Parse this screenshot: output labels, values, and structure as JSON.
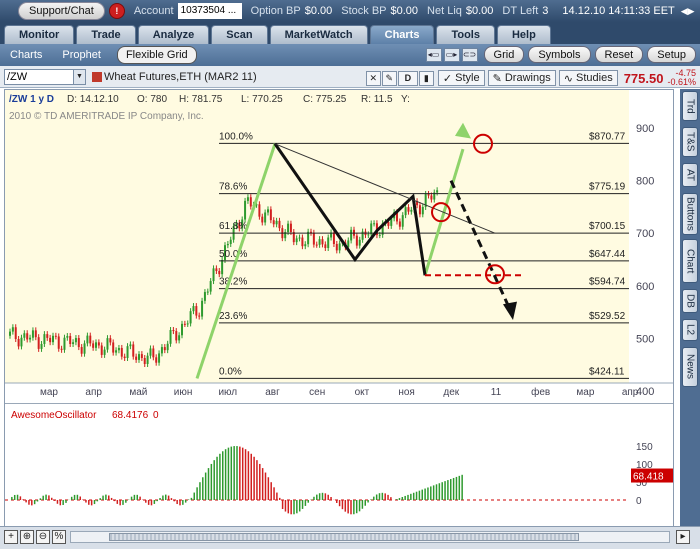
{
  "topbar": {
    "support_label": "Support/Chat",
    "alert_count": "!",
    "account_label": "Account",
    "account_value": "10373504 ...",
    "option_bp_label": "Option BP",
    "option_bp_value": "$0.00",
    "stock_bp_label": "Stock BP",
    "stock_bp_value": "$0.00",
    "net_liq_label": "Net Liq",
    "net_liq_value": "$0.00",
    "dt_left_label": "DT Left",
    "dt_left_value": "3",
    "datetime": "14.12.10 14:11:33 EET"
  },
  "nav": {
    "tabs": [
      "Monitor",
      "Trade",
      "Analyze",
      "Scan",
      "MarketWatch",
      "Charts",
      "Tools",
      "Help"
    ],
    "active": "Charts"
  },
  "subnav": {
    "tabs": [
      "Charts",
      "Prophet",
      "Flexible Grid"
    ],
    "active": "Flexible Grid",
    "buttons": {
      "grid": "Grid",
      "symbols": "Symbols",
      "reset": "Reset",
      "setup": "Setup"
    }
  },
  "chartbar": {
    "symbol": "/ZW",
    "description": "Wheat Futures,ETH (MAR2 11)",
    "d_label": "D",
    "style_label": "Style",
    "drawings_label": "Drawings",
    "studies_label": "Studies",
    "last_price": "775.50",
    "change": "-4.75",
    "change_pct": "-0.61%"
  },
  "chart_info": {
    "symbol_period": "/ZW 1 y D",
    "date": "D: 14.12.10",
    "open": "O: 780",
    "high": "H: 781.75",
    "low": "L: 770.25",
    "close": "C: 775.25",
    "range": "R: 11.5",
    "y_label": "Y:",
    "copyright": "2010 © TD AMERITRADE IP Company, Inc."
  },
  "fib_levels": [
    {
      "pct": "100.0%",
      "price": "$870.77",
      "value": 870.77
    },
    {
      "pct": "78.6%",
      "price": "$775.19",
      "value": 775.19
    },
    {
      "pct": "61.8%",
      "price": "$700.15",
      "value": 700.15
    },
    {
      "pct": "50.0%",
      "price": "$647.44",
      "value": 647.44
    },
    {
      "pct": "38.2%",
      "price": "$594.74",
      "value": 594.74
    },
    {
      "pct": "23.6%",
      "price": "$529.52",
      "value": 529.52
    },
    {
      "pct": "0.0%",
      "price": "$424.11",
      "value": 424.11
    }
  ],
  "price_axis": [
    "900",
    "800",
    "700",
    "600",
    "500",
    "400"
  ],
  "months": [
    "мар",
    "апр",
    "май",
    "июн",
    "июл",
    "авг",
    "сен",
    "окт",
    "ноя",
    "дек",
    "11",
    "фев",
    "мар",
    "апр"
  ],
  "oscillator": {
    "name": "AwesomeOscillator",
    "value": "68.4176",
    "extra": "0",
    "axis": [
      "150",
      "100",
      "50",
      "0"
    ],
    "last_badge": "68.418"
  },
  "side_tabs": [
    "Trd",
    "T&S",
    "AT",
    "Buttons",
    "Chart",
    "DB",
    "L2",
    "News"
  ],
  "colors": {
    "up": "#2e9a2e",
    "down": "#d21f1f",
    "chart_bg": "#fffbe1",
    "accent_green": "#8ed36a"
  },
  "chart_data": {
    "type": "line",
    "title": "Wheat Futures,ETH (MAR2 11)",
    "ylim": [
      400,
      900
    ],
    "series": [
      {
        "name": "/ZW",
        "x": [
          "мар",
          "апр",
          "май",
          "июн",
          "июл",
          "авг",
          "сен",
          "окт",
          "ноя",
          "дек"
        ],
        "values": [
          505,
          495,
          485,
          460,
          560,
          760,
          690,
          680,
          720,
          775
        ]
      }
    ]
  }
}
